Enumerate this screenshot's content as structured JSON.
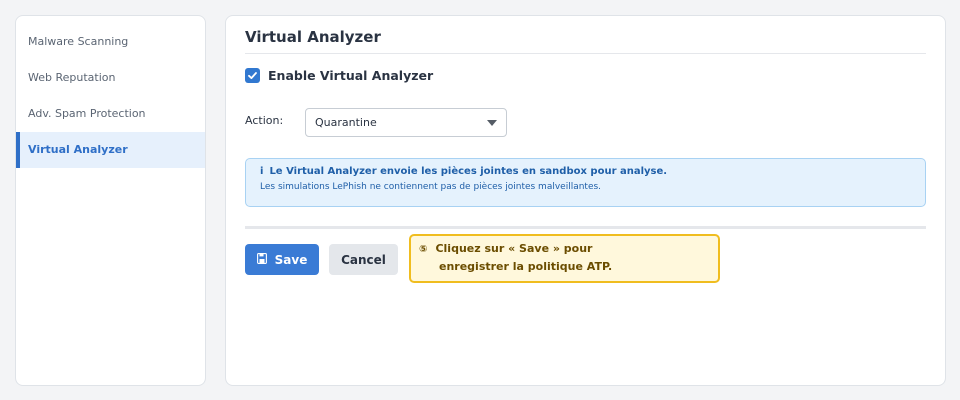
{
  "sidebar": {
    "items": [
      {
        "label": "Malware Scanning"
      },
      {
        "label": "Web Reputation"
      },
      {
        "label": "Adv. Spam Protection"
      },
      {
        "label": "Virtual Analyzer"
      }
    ],
    "active_index": 3
  },
  "main": {
    "title": "Virtual Analyzer",
    "enable_checkbox": {
      "label": "Enable Virtual Analyzer",
      "checked": true
    },
    "action": {
      "label": "Action:",
      "selected": "Quarantine"
    },
    "info": {
      "icon": "i",
      "line1": "Le Virtual Analyzer envoie les pièces jointes en sandbox pour analyse.",
      "line2": "Les simulations LePhish ne contiennent pas de pièces jointes malveillantes."
    },
    "buttons": {
      "save": "Save",
      "cancel": "Cancel"
    },
    "tooltip": {
      "step": "⑤",
      "line1": "Cliquez sur « Save » pour",
      "line2": "enregistrer la politique ATP."
    }
  },
  "colors": {
    "accent": "#3a7bd5",
    "sidebar_active_bg": "#e6f0fc",
    "info_bg": "#e5f2fd",
    "tooltip_bg": "#fff8dc",
    "tooltip_border": "#f0bd1f"
  },
  "icons": {
    "checkbox": "check-icon",
    "select": "chevron-down-icon",
    "info": "info-icon",
    "save": "save-icon"
  }
}
